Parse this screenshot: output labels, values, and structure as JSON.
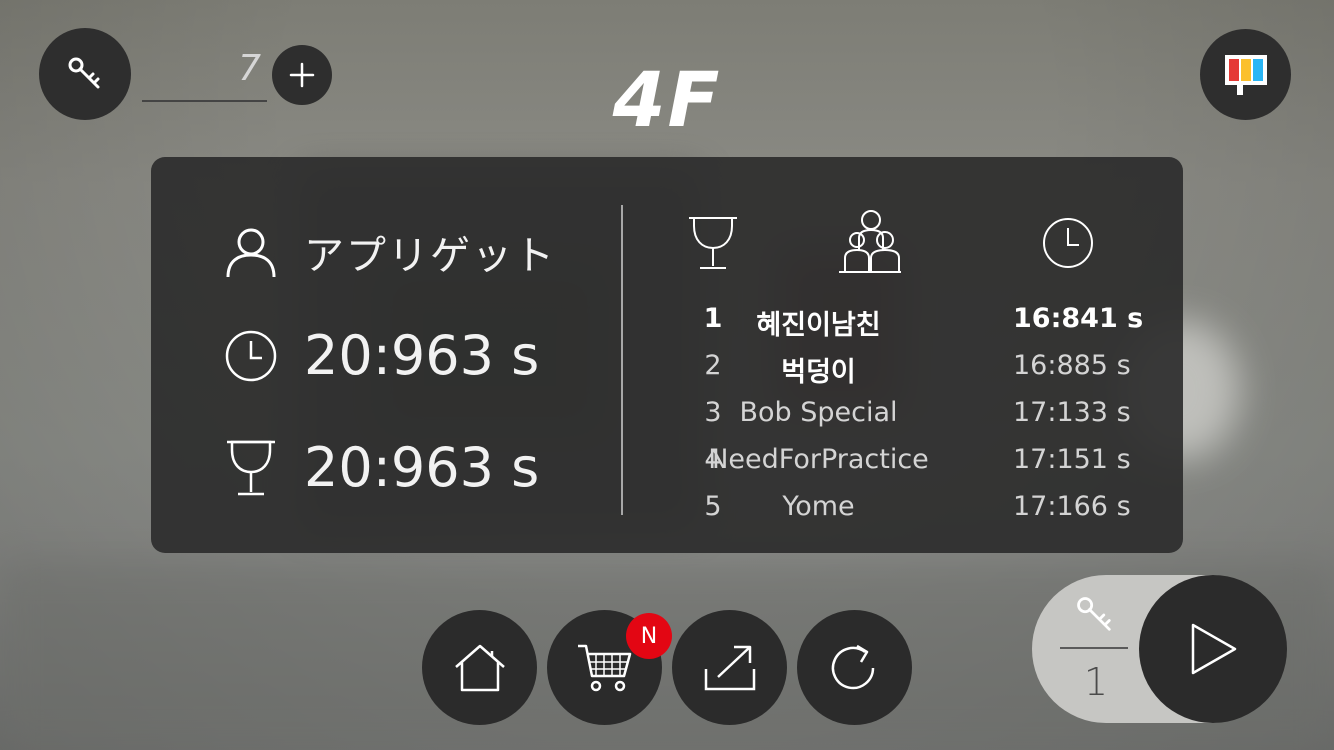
{
  "header": {
    "key_count": "7",
    "floor": "4F"
  },
  "player": {
    "name": "アプリゲット",
    "time": "20:963 s",
    "best": "20:963 s"
  },
  "leaderboard": [
    {
      "rank": "1",
      "name": "혜진이남친",
      "time": "16:841 s"
    },
    {
      "rank": "2",
      "name": "벅덩이",
      "time": "16:885 s"
    },
    {
      "rank": "3",
      "name": "Bob Special",
      "time": "17:133 s"
    },
    {
      "rank": "4",
      "name": "NeedForPractice",
      "time": "17:151 s"
    },
    {
      "rank": "5",
      "name": "Yome",
      "time": "17:166 s"
    }
  ],
  "bottom_bar": {
    "cart_badge": "N",
    "icons": [
      "home-icon",
      "cart-icon",
      "share-icon",
      "retry-icon"
    ]
  },
  "play": {
    "key_cost": "1"
  },
  "colors": {
    "panel": "#2d2d2d",
    "button": "#2b2b2b",
    "badge": "#e30613"
  }
}
